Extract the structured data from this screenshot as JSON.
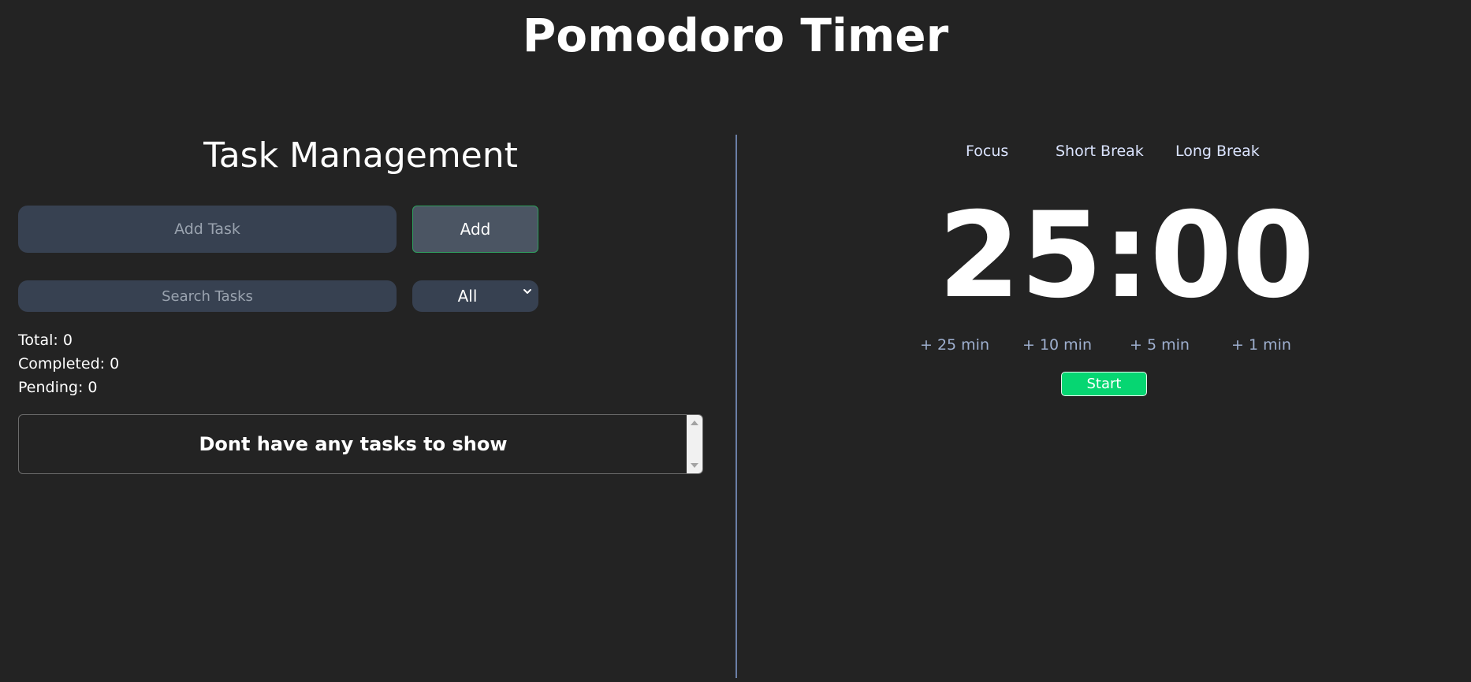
{
  "app": {
    "title": "Pomodoro Timer"
  },
  "tasks": {
    "heading": "Task Management",
    "add_placeholder": "Add Task",
    "add_label": "Add",
    "search_placeholder": "Search Tasks",
    "filter_value": "All",
    "stats": {
      "total": "Total: 0",
      "completed": "Completed: 0",
      "pending": "Pending: 0"
    },
    "empty_message": "Dont have any tasks to show"
  },
  "timer": {
    "modes": [
      "Focus",
      "Short Break",
      "Long Break"
    ],
    "display": "25:00",
    "add_options": [
      "+ 25 min",
      "+ 10 min",
      "+ 5 min",
      "+ 1 min"
    ],
    "start_label": "Start"
  },
  "colors": {
    "background": "#232323",
    "input_bg": "#374151",
    "start_green": "#06d672",
    "divider": "#6b7fa6"
  }
}
